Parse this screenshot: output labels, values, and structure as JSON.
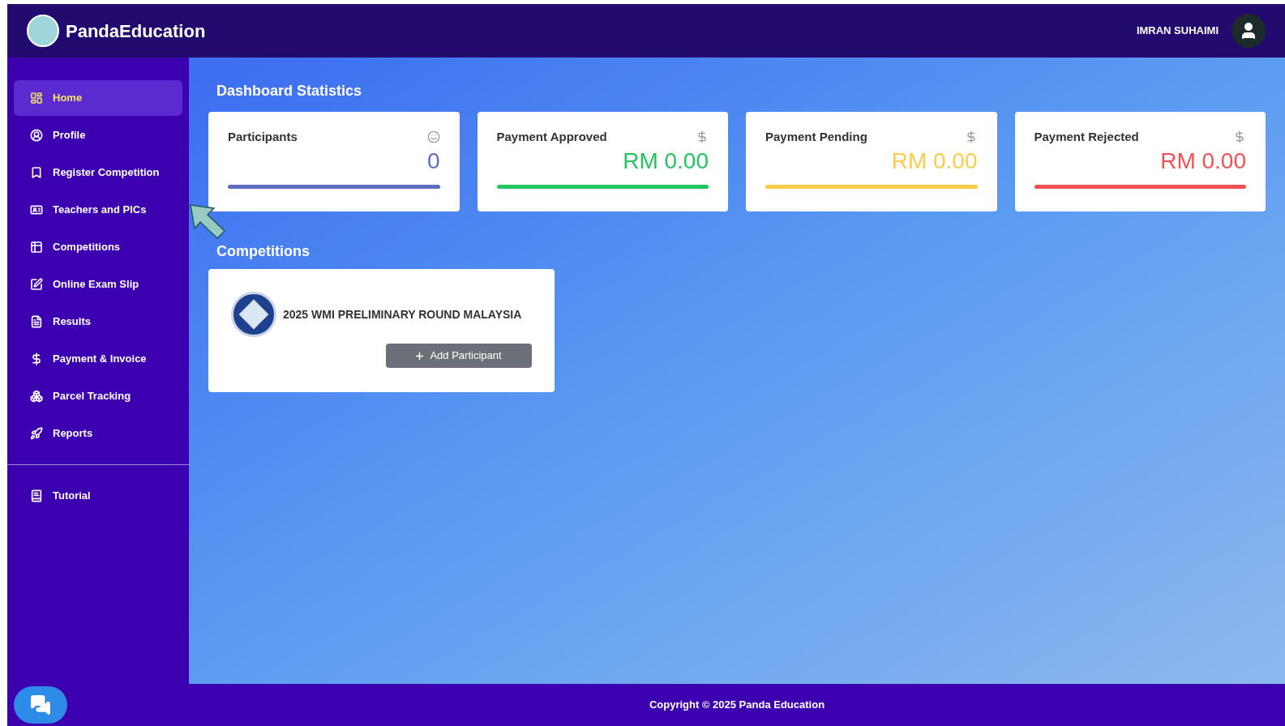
{
  "header": {
    "brand": "PandaEducation",
    "user": "IMRAN SUHAIMI"
  },
  "sidebar": {
    "items": [
      {
        "label": "Home",
        "selected": true
      },
      {
        "label": "Profile",
        "selected": false
      },
      {
        "label": "Register Competition",
        "selected": false
      },
      {
        "label": "Teachers and PICs",
        "selected": false
      },
      {
        "label": "Competitions",
        "selected": false
      },
      {
        "label": "Online Exam Slip",
        "selected": false
      },
      {
        "label": "Results",
        "selected": false
      },
      {
        "label": "Payment & Invoice",
        "selected": false
      },
      {
        "label": "Parcel Tracking",
        "selected": false
      },
      {
        "label": "Reports",
        "selected": false
      }
    ],
    "bottom_items": [
      {
        "label": "Tutorial",
        "selected": false
      }
    ]
  },
  "stats": {
    "title": "Dashboard Statistics",
    "cards": [
      {
        "label": "Participants",
        "value": "0",
        "kind": "count",
        "color": "#5c6bc0"
      },
      {
        "label": "Payment Approved",
        "value": "RM 0.00",
        "kind": "money",
        "color": "#22c55e"
      },
      {
        "label": "Payment Pending",
        "value": "RM 0.00",
        "kind": "money",
        "color": "#facc4a"
      },
      {
        "label": "Payment Rejected",
        "value": "RM 0.00",
        "kind": "money",
        "color": "#f05252"
      }
    ]
  },
  "competitions": {
    "title": "Competitions",
    "items": [
      {
        "name": "2025 WMI PRELIMINARY ROUND MALAYSIA",
        "button": "Add Participant"
      }
    ]
  },
  "footer": {
    "copyright": "Copyright © 2025 Panda Education"
  }
}
